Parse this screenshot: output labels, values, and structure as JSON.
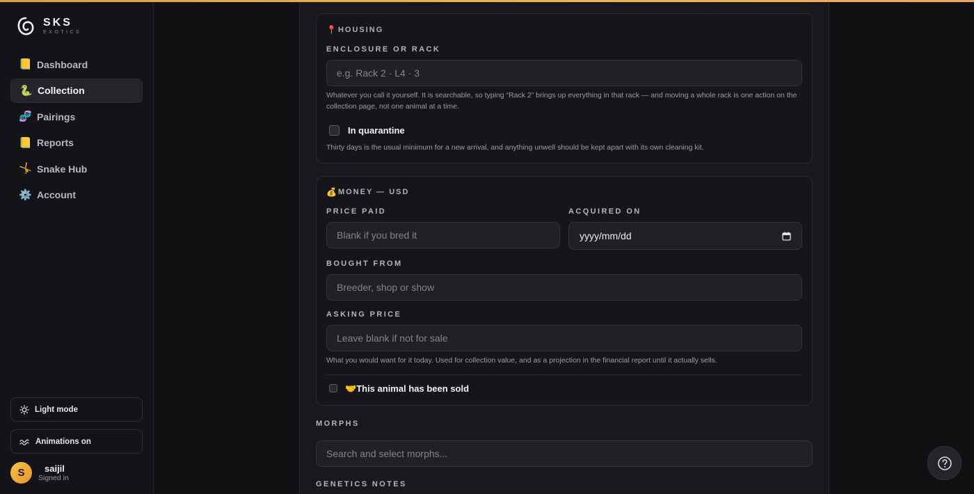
{
  "brand": {
    "name": "SKS",
    "subtitle": "EXOTICS"
  },
  "nav": [
    {
      "label": "Dashboard",
      "icon": "📒",
      "active": false
    },
    {
      "label": "Collection",
      "icon": "🐍",
      "active": true
    },
    {
      "label": "Pairings",
      "icon": "🧬",
      "active": false
    },
    {
      "label": "Reports",
      "icon": "📒",
      "active": false
    },
    {
      "label": "Snake Hub",
      "icon": "🤸",
      "active": false
    },
    {
      "label": "Account",
      "icon": "⚙️",
      "active": false
    }
  ],
  "sidebar_controls": {
    "light_mode": "Light mode",
    "animations": "Animations on"
  },
  "user": {
    "initial": "S",
    "name": "saijil",
    "status": "Signed in"
  },
  "housing": {
    "icon": "📍",
    "title": "HOUSING",
    "enclosure_label": "ENCLOSURE OR RACK",
    "enclosure_placeholder": "e.g. Rack 2 · L4 · 3",
    "enclosure_hint": "Whatever you call it yourself. It is searchable, so typing “Rack 2” brings up everything in that rack — and moving a whole rack is one action on the collection page, not one animal at a time.",
    "quarantine_label": "In quarantine",
    "quarantine_checked": false,
    "quarantine_hint": "Thirty days is the usual minimum for a new arrival, and anything unwell should be kept apart with its own cleaning kit."
  },
  "money": {
    "icon": "💰",
    "title": "MONEY — USD",
    "price_label": "PRICE PAID",
    "price_placeholder": "Blank if you bred it",
    "acquired_label": "ACQUIRED ON",
    "acquired_value": "yyyy/mm/dd",
    "bought_label": "BOUGHT FROM",
    "bought_placeholder": "Breeder, shop or show",
    "asking_label": "ASKING PRICE",
    "asking_placeholder": "Leave blank if not for sale",
    "asking_hint": "What you would want for it today. Used for collection value, and as a projection in the financial report until it actually sells.",
    "sold_icon": "🤝",
    "sold_label": "This animal has been sold",
    "sold_checked": false
  },
  "morphs": {
    "label": "MORPHS",
    "placeholder": "Search and select morphs..."
  },
  "genetics": {
    "label": "GENETICS NOTES"
  },
  "colors": {
    "accent": "#f0b84a",
    "background": "#111114",
    "panel": "#19191d"
  }
}
